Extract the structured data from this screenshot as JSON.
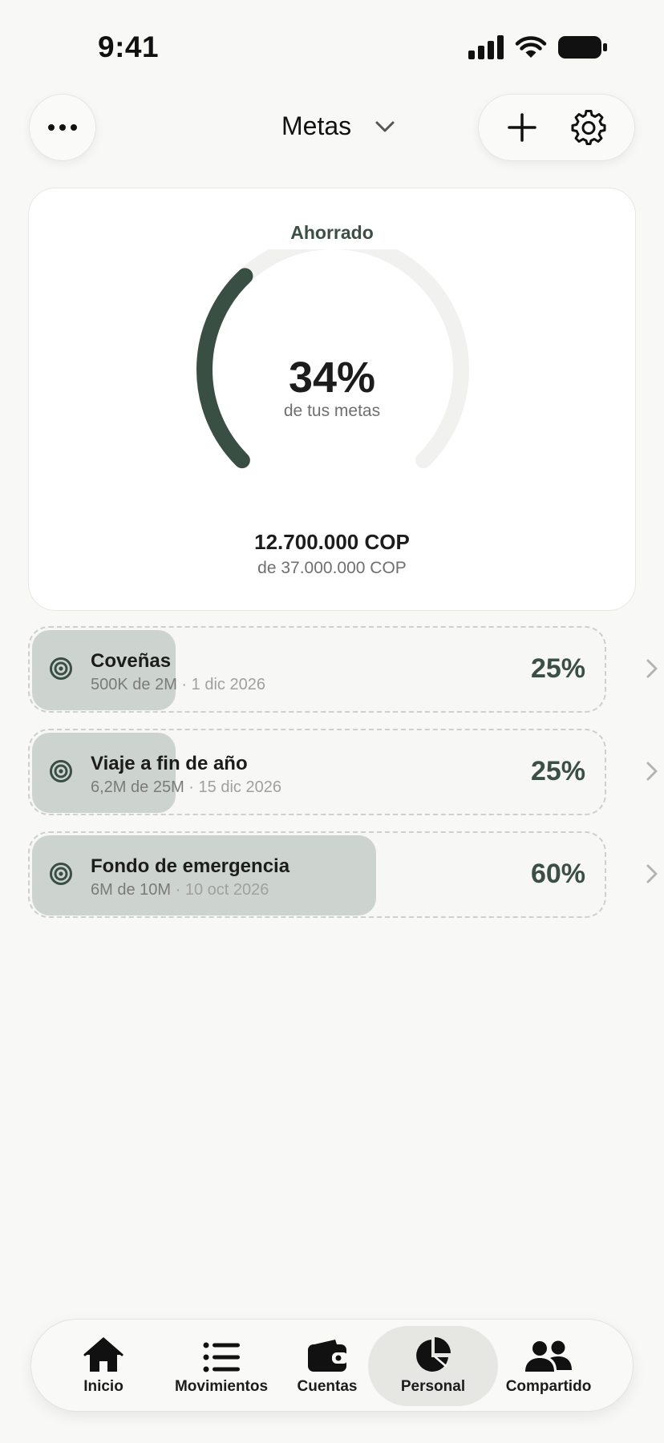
{
  "status_bar": {
    "time": "9:41"
  },
  "header": {
    "title": "Metas",
    "icons": {
      "menu": "ellipsis-icon",
      "dropdown": "chevron-down-icon",
      "add": "plus-icon",
      "settings": "gear-icon"
    }
  },
  "summary": {
    "label": "Ahorrado",
    "percent": "34%",
    "percent_value": 34,
    "subtitle": "de tus metas",
    "saved": "12.700.000 COP",
    "target": "de 37.000.000 COP"
  },
  "goals": [
    {
      "name": "Coveñas",
      "progress": "500K de 2M",
      "separator": "·",
      "date": "1 dic 2026",
      "percent": "25%",
      "fill": 0.25
    },
    {
      "name": "Viaje a fin de año",
      "progress": "6,2M de 25M",
      "separator": "·",
      "date": "15 dic 2026",
      "percent": "25%",
      "fill": 0.25
    },
    {
      "name": "Fondo de emergencia",
      "progress": "6M de 10M",
      "separator": "·",
      "date": "10 oct 2026",
      "percent": "60%",
      "fill": 0.6
    }
  ],
  "tabs": [
    {
      "label": "Inicio",
      "icon": "home-icon"
    },
    {
      "label": "Movimientos",
      "icon": "list-icon"
    },
    {
      "label": "Cuentas",
      "icon": "wallet-icon"
    },
    {
      "label": "Personal",
      "icon": "pie-chart-icon",
      "active": true
    },
    {
      "label": "Compartido",
      "icon": "people-icon"
    }
  ],
  "colors": {
    "accent": "#3a4f43",
    "fill": "#cdd3cf",
    "track": "#f1f1ef",
    "background": "#f8f8f6"
  }
}
